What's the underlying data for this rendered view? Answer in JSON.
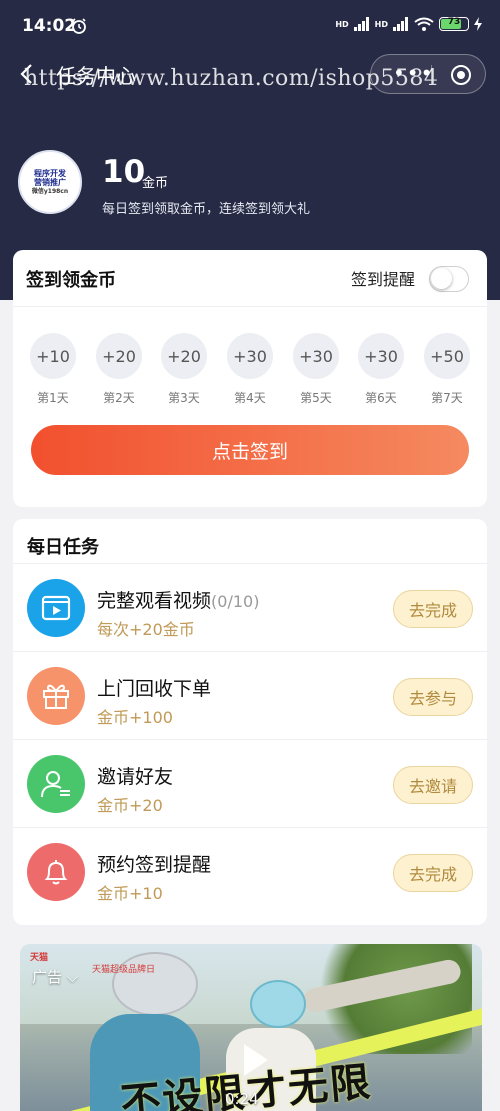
{
  "status_bar": {
    "time": "14:02",
    "network": "HD",
    "network2": "HD",
    "battery": "73"
  },
  "nav": {
    "title": "任务中心",
    "watermark": "https://www.huzhan.com/ishop5584"
  },
  "user": {
    "avatar_line1": "程序开发",
    "avatar_line2": "营销推广",
    "avatar_line3": "微信y198cn",
    "coins": "10",
    "coin_unit": "金币",
    "description": "每日签到领取金币，连续签到领大礼"
  },
  "signin": {
    "title": "签到领金币",
    "remind_label": "签到提醒",
    "remind_on": false,
    "days": [
      {
        "reward": "+10",
        "label": "第1天"
      },
      {
        "reward": "+20",
        "label": "第2天"
      },
      {
        "reward": "+20",
        "label": "第3天"
      },
      {
        "reward": "+30",
        "label": "第4天"
      },
      {
        "reward": "+30",
        "label": "第5天"
      },
      {
        "reward": "+30",
        "label": "第6天"
      },
      {
        "reward": "+50",
        "label": "第7天"
      }
    ],
    "button_label": "点击签到"
  },
  "tasks": {
    "title": "每日任务",
    "items": [
      {
        "name": "完整观看视频",
        "progress": "(0/10)",
        "reward": "每次+20金币",
        "button": "去完成",
        "icon": "video-icon",
        "color": "#1aa3e8"
      },
      {
        "name": "上门回收下单",
        "progress": "",
        "reward": "金币+100",
        "button": "去参与",
        "icon": "gift-icon",
        "color": "#f7936a"
      },
      {
        "name": "邀请好友",
        "progress": "",
        "reward": "金币+20",
        "button": "去邀请",
        "icon": "user-icon",
        "color": "#49c66b"
      },
      {
        "name": "预约签到提醒",
        "progress": "",
        "reward": "金币+10",
        "button": "去完成",
        "icon": "bell-icon",
        "color": "#ee6b6b"
      }
    ]
  },
  "ad": {
    "label": "广告",
    "brand1": "天猫",
    "brand2": "天猫超级品牌日",
    "headline": "不设限才无限",
    "time": "0:24"
  }
}
